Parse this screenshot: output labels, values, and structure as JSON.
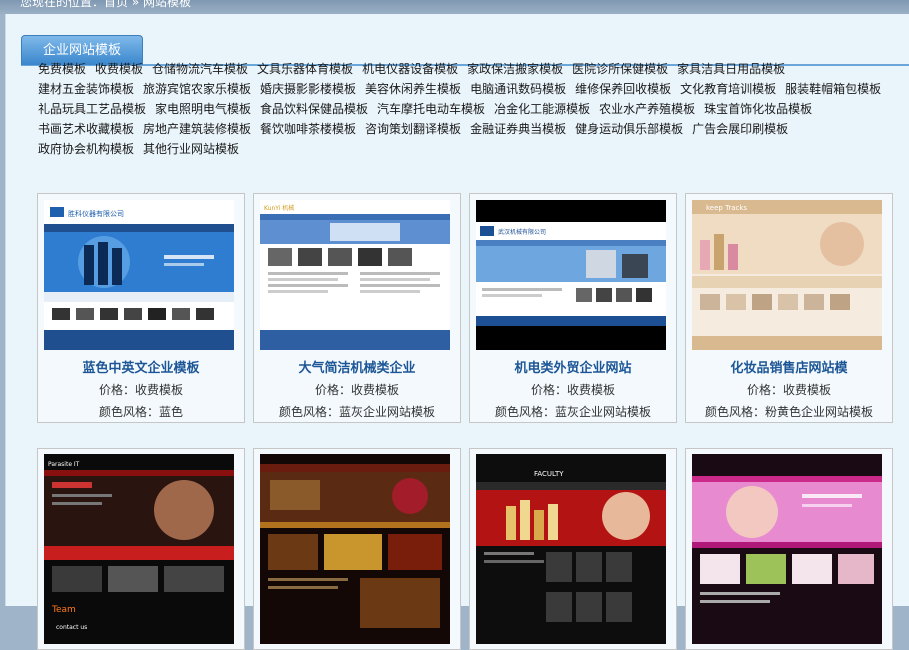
{
  "breadcrumb": "您现在的位置：首页 » 网站模板",
  "tab": {
    "label": "企业网站模板"
  },
  "categories": [
    "免费模板",
    "收费模板",
    "仓储物流汽车模板",
    "文具乐器体育模板",
    "机电仪器设备模板",
    "家政保洁搬家模板",
    "医院诊所保健模板",
    "家具洁具日用品模板",
    "建材五金装饰模板",
    "旅游宾馆农家乐模板",
    "婚庆摄影影楼模板",
    "美容休闲养生模板",
    "电脑通讯数码模板",
    "维修保养回收模板",
    "文化教育培训模板",
    "服装鞋帽箱包模板",
    "礼品玩具工艺品模板",
    "家电照明电气模板",
    "食品饮料保健品模板",
    "汽车摩托电动车模板",
    "冶金化工能源模板",
    "农业水产养殖模板",
    "珠宝首饰化妆品模板",
    "书画艺术收藏模板",
    "房地产建筑装修模板",
    "餐饮咖啡茶楼模板",
    "咨询策划翻译模板",
    "金融证券典当模板",
    "健身运动俱乐部模板",
    "广告会展印刷模板",
    "政府协会机构模板",
    "其他行业网站模板"
  ],
  "templates": [
    {
      "title": "蓝色中英文企业模板",
      "price": "价格：收费模板",
      "style": "颜色风格：蓝色"
    },
    {
      "title": "大气简洁机械类企业",
      "price": "价格：收费模板",
      "style": "颜色风格：蓝灰企业网站模板"
    },
    {
      "title": "机电类外贸企业网站",
      "price": "价格：收费模板",
      "style": "颜色风格：蓝灰企业网站模板"
    },
    {
      "title": "化妆品销售店网站模",
      "price": "价格：收费模板",
      "style": "颜色风格：粉黄色企业网站模板"
    }
  ],
  "thumb_texts": {
    "t1_brand": "胜科仪器有限公司",
    "t2_brand": "KunYi 机械",
    "t3_brand": "武汉机械有限公司",
    "t4_brand": "keep Tracks",
    "t5_brand": "Parasite IT",
    "t5_team": "Team",
    "t5_contact": "contact us",
    "t7_brand": "FACULTY"
  }
}
